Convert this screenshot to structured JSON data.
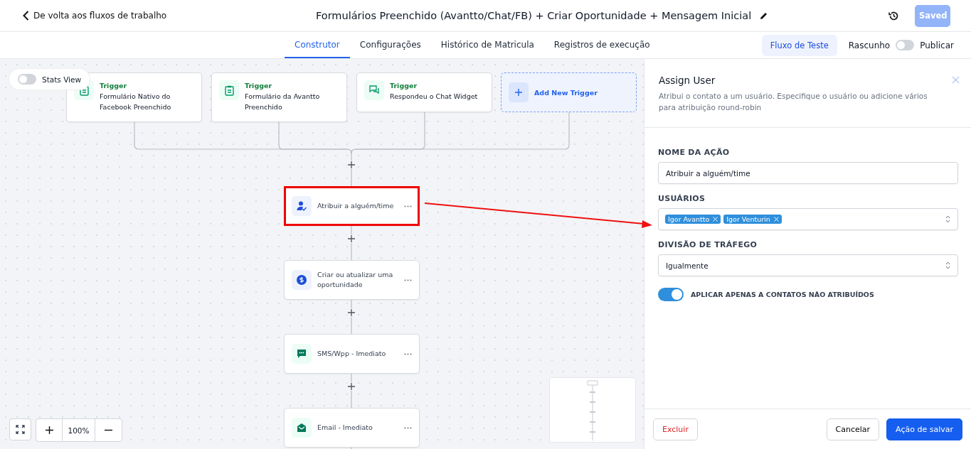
{
  "header": {
    "back_label": "De volta aos fluxos de trabalho",
    "title": "Formulários Preenchido (Avantto/Chat/FB) + Criar Oportunidade + Mensagem Inicial",
    "saved_button": "Saved"
  },
  "tabs": [
    {
      "label": "Construtor",
      "selected": true
    },
    {
      "label": "Configurações",
      "selected": false
    },
    {
      "label": "Histórico de Matricula",
      "selected": false
    },
    {
      "label": "Registros de execução",
      "selected": false
    }
  ],
  "test_flow_button": "Fluxo de Teste",
  "draft_label": "Rascunho",
  "publish": {
    "on": false
  },
  "publish_label": "Publicar",
  "canvas": {
    "stats_view": {
      "label": "Stats View",
      "on": false
    },
    "triggers": [
      {
        "kind": "form",
        "heading": "Trigger",
        "text": "Formulário Nativo do Facebook Preenchido"
      },
      {
        "kind": "form",
        "heading": "Trigger",
        "text": "Formulário da Avantto Preenchido"
      },
      {
        "kind": "chat",
        "heading": "Trigger",
        "text": "Respondeu o Chat Widget"
      }
    ],
    "add_trigger": "Add New Trigger",
    "actions": [
      {
        "kind": "assign",
        "label": "Atribuir a alguém/time",
        "selected": true
      },
      {
        "kind": "opportunity",
        "label": "Criar ou atualizar uma oportunidade",
        "selected": false
      },
      {
        "kind": "sms",
        "label": "SMS/Wpp - Imediato",
        "selected": false
      },
      {
        "kind": "email",
        "label": "Email - Imediato",
        "selected": false
      }
    ],
    "zoom": "100%"
  },
  "panel": {
    "title": "Assign User",
    "description": "Atribui o contato a um usuário. Especifique o usuário ou adicione vários para atribuição round-robin",
    "action_name_label": "NOME DA AÇÃO",
    "action_name_value": "Atribuir a alguém/time",
    "users_label": "USUÁRIOS",
    "users": [
      "Igor Avantto",
      "Igor Venturin"
    ],
    "traffic_label": "DIVISÃO DE TRÁFEGO",
    "traffic_value": "Igualmente",
    "unassigned_only": {
      "label": "APLICAR APENAS A CONTATOS NÃO ATRIBUÍDOS",
      "on": true
    },
    "delete_button": "Excluir",
    "cancel_button": "Cancelar",
    "save_button": "Ação de salvar"
  }
}
